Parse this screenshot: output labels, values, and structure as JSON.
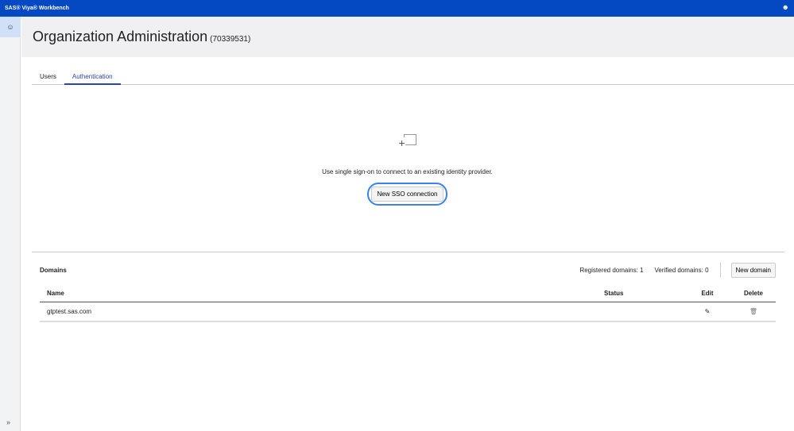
{
  "app_title": "SAS® Viya® Workbench",
  "page": {
    "title": "Organization Administration",
    "org_id": "(70339531)"
  },
  "tabs": [
    {
      "label": "Users"
    },
    {
      "label": "Authentication"
    }
  ],
  "sso": {
    "message": "Use single sign-on to connect to an existing identity provider.",
    "button": "New SSO connection"
  },
  "domains": {
    "title": "Domains",
    "registered": "Registered domains: 1",
    "verified": "Verified domains: 0",
    "new_button": "New domain",
    "columns": [
      "Name",
      "Status",
      "Edit",
      "Delete"
    ],
    "rows": [
      {
        "name": "gtptest.sas.com",
        "status": ""
      }
    ]
  }
}
